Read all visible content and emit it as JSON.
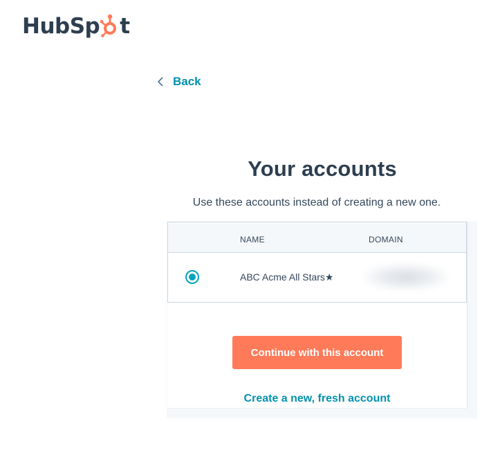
{
  "brand": {
    "name": "HubSpot",
    "text_before": "HubSp",
    "text_after": "t",
    "colors": {
      "dark": "#2d3e50",
      "accent": "#ff7a59"
    }
  },
  "nav": {
    "back_label": "Back",
    "back_icon": "chevron-left-icon"
  },
  "main": {
    "title": "Your accounts",
    "subtitle": "Use these accounts instead of creating a new one."
  },
  "accounts_table": {
    "columns": [
      "NAME",
      "DOMAIN"
    ],
    "rows": [
      {
        "selected": true,
        "name": "ABC Acme All Stars★",
        "domain": ""
      }
    ]
  },
  "actions": {
    "continue_label": "Continue with this account",
    "create_label": "Create a new, fresh account"
  },
  "colors": {
    "primary_button": "#ff7a59",
    "link": "#0091ae",
    "radio": "#00a4bd",
    "header_bg": "#f5f8fa",
    "border": "#cbd6e2"
  }
}
